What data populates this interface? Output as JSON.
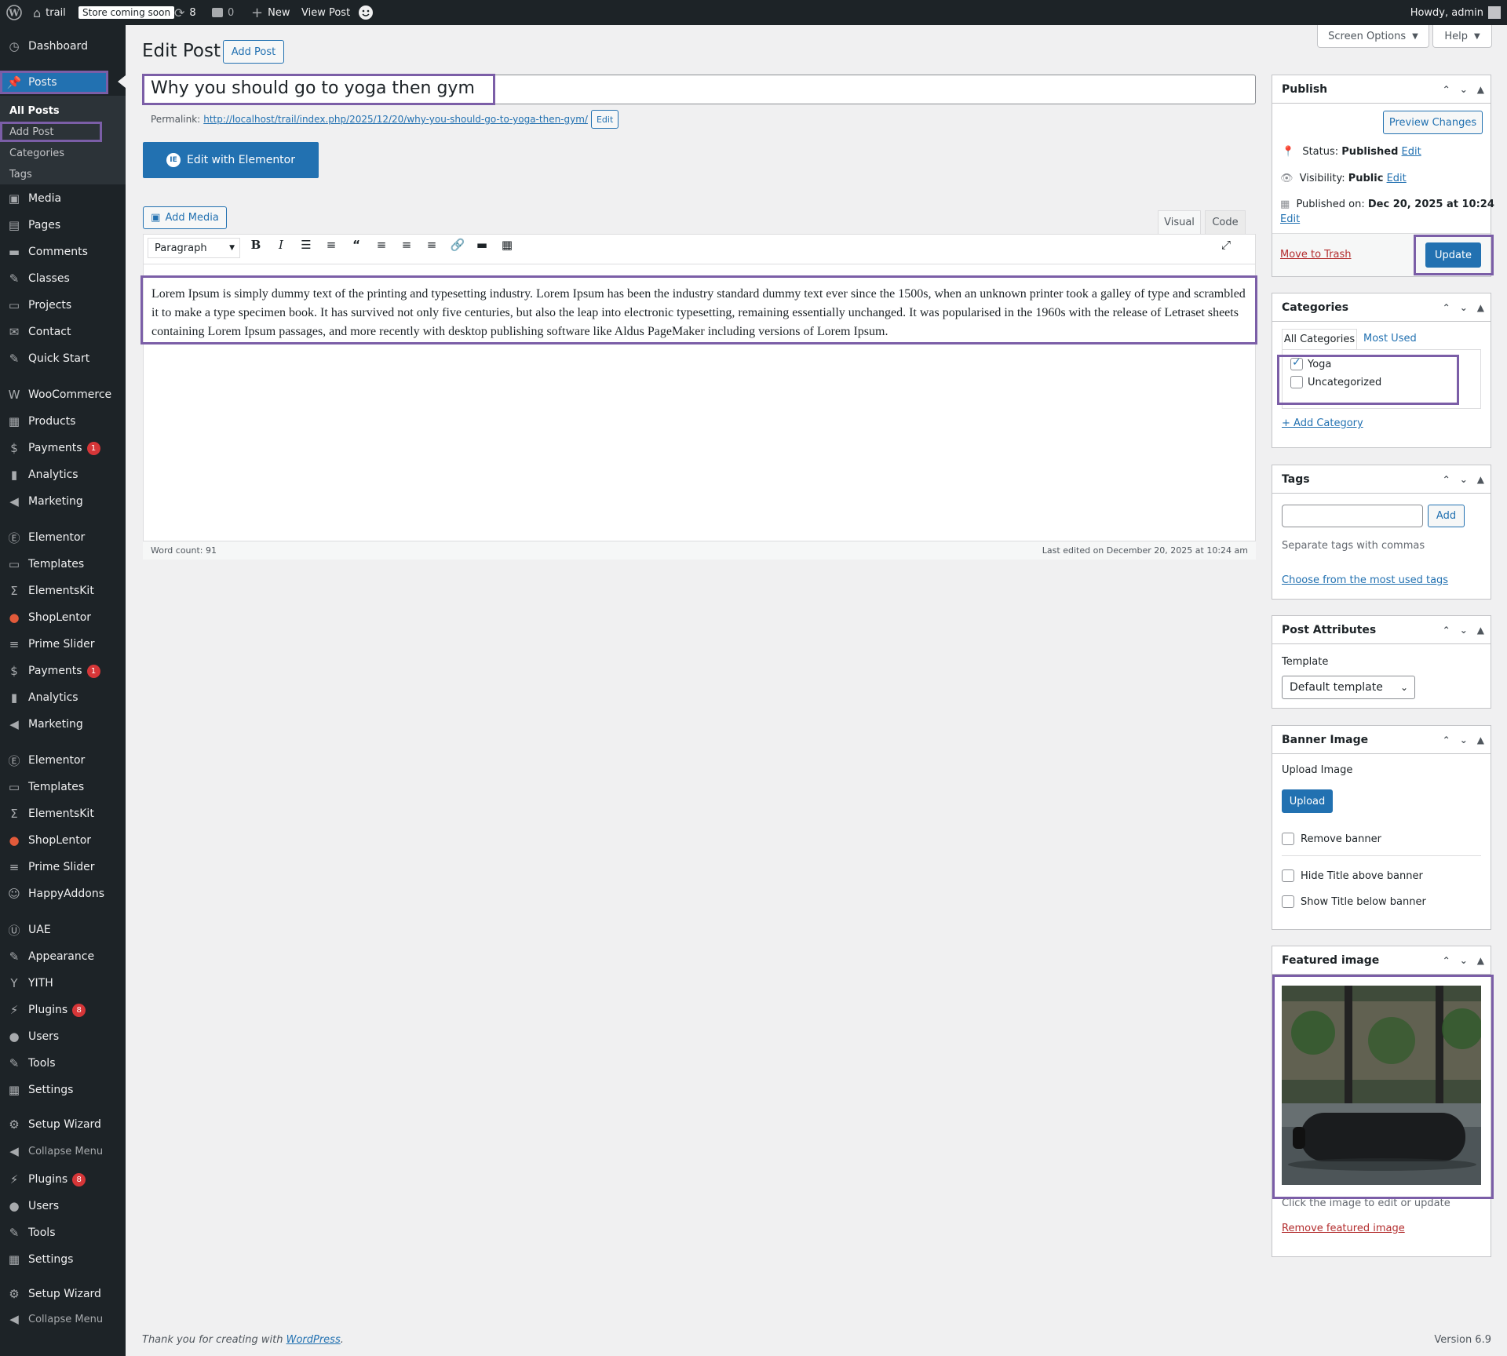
{
  "adminbar": {
    "site_name": "trail",
    "store_badge": "Store coming soon",
    "updates_count": "8",
    "comments_count": "0",
    "new_label": "New",
    "view_post_label": "View Post",
    "howdy": "Howdy, admin"
  },
  "sidebar": {
    "items": [
      {
        "label": "Dashboard",
        "icon": "dashboard-icon"
      },
      {
        "label": "Posts",
        "icon": "pin-icon"
      },
      {
        "label": "Media",
        "icon": "media-icon"
      },
      {
        "label": "Pages",
        "icon": "pages-icon"
      },
      {
        "label": "Comments",
        "icon": "comments-icon"
      },
      {
        "label": "Classes",
        "icon": "wrench-icon"
      },
      {
        "label": "Projects",
        "icon": "folder-icon"
      },
      {
        "label": "Contact",
        "icon": "mail-icon"
      },
      {
        "label": "Quick Start",
        "icon": "wrench-icon"
      },
      {
        "label": "WooCommerce",
        "icon": "woo-icon"
      },
      {
        "label": "Products",
        "icon": "archive-icon"
      },
      {
        "label": "Payments",
        "icon": "payments-icon",
        "badge": "1"
      },
      {
        "label": "Analytics",
        "icon": "analytics-icon"
      },
      {
        "label": "Marketing",
        "icon": "megaphone-icon"
      },
      {
        "label": "Elementor",
        "icon": "elementor-icon"
      },
      {
        "label": "Templates",
        "icon": "folder-icon"
      },
      {
        "label": "ElementsKit",
        "icon": "ekit-icon"
      },
      {
        "label": "ShopLentor",
        "icon": "shoplentor-icon"
      },
      {
        "label": "Prime Slider",
        "icon": "slider-icon"
      },
      {
        "label": "Payments",
        "icon": "payments-icon",
        "badge": "1"
      },
      {
        "label": "Analytics",
        "icon": "analytics-icon"
      },
      {
        "label": "Marketing",
        "icon": "megaphone-icon"
      },
      {
        "label": "Elementor",
        "icon": "elementor-icon"
      },
      {
        "label": "Templates",
        "icon": "folder-icon"
      },
      {
        "label": "ElementsKit",
        "icon": "ekit-icon"
      },
      {
        "label": "ShopLentor",
        "icon": "shoplentor-icon"
      },
      {
        "label": "Prime Slider",
        "icon": "slider-icon"
      },
      {
        "label": "HappyAddons",
        "icon": "happy-icon"
      },
      {
        "label": "UAE",
        "icon": "uae-icon"
      },
      {
        "label": "Appearance",
        "icon": "brush-icon"
      },
      {
        "label": "YITH",
        "icon": "yith-icon"
      },
      {
        "label": "Plugins",
        "icon": "plugin-icon",
        "badge": "8"
      },
      {
        "label": "Users",
        "icon": "users-icon"
      },
      {
        "label": "Tools",
        "icon": "wrench-icon"
      },
      {
        "label": "Settings",
        "icon": "settings-icon"
      },
      {
        "label": "Setup Wizard",
        "icon": "gear-icon"
      },
      {
        "label": "Collapse Menu",
        "icon": "collapse-icon"
      },
      {
        "label": "Plugins",
        "icon": "plugin-icon",
        "badge": "8"
      },
      {
        "label": "Users",
        "icon": "users-icon"
      },
      {
        "label": "Tools",
        "icon": "wrench-icon"
      },
      {
        "label": "Settings",
        "icon": "settings-icon"
      },
      {
        "label": "Setup Wizard",
        "icon": "gear-icon"
      },
      {
        "label": "Collapse Menu",
        "icon": "collapse-icon"
      }
    ],
    "posts_submenu": [
      "All Posts",
      "Add Post",
      "Categories",
      "Tags"
    ]
  },
  "header": {
    "page_title": "Edit Post",
    "add_post_button": "Add Post",
    "screen_options": "Screen Options",
    "help": "Help"
  },
  "editor": {
    "post_title": "Why you should go to yoga then gym",
    "permalink_label": "Permalink:",
    "permalink_url": "http://localhost/trail/index.php/2025/12/20/why-you-should-go-to-yoga-then-gym/",
    "permalink_edit": "Edit",
    "elementor_button": "Edit with Elementor",
    "add_media": "Add Media",
    "tab_visual": "Visual",
    "tab_code": "Code",
    "format_select": "Paragraph",
    "content": "Lorem Ipsum is simply dummy text of the printing and typesetting industry. Lorem Ipsum has been the industry standard dummy text ever since the 1500s, when an unknown printer took a galley of type and scrambled it to make a type specimen book. It has survived not only five centuries, but also the leap into electronic typesetting, remaining essentially unchanged. It was popularised in the 1960s with the release of Letraset sheets containing Lorem Ipsum passages, and more recently with desktop publishing software like Aldus PageMaker including versions of Lorem Ipsum.",
    "word_count": "Word count: 91",
    "last_edited": "Last edited on December 20, 2025 at 10:24 am"
  },
  "publish": {
    "title": "Publish",
    "preview_button": "Preview Changes",
    "status_label": "Status:",
    "status_value": "Published",
    "visibility_label": "Visibility:",
    "visibility_value": "Public",
    "published_label": "Published on:",
    "published_value": "Dec 20, 2025 at 10:24",
    "edit_link": "Edit",
    "trash_link": "Move to Trash",
    "update_button": "Update"
  },
  "categories": {
    "title": "Categories",
    "tab_all": "All Categories",
    "tab_used": "Most Used",
    "items": [
      {
        "label": "Yoga",
        "checked": true
      },
      {
        "label": "Uncategorized",
        "checked": false
      }
    ],
    "add_link": "+ Add Category"
  },
  "tags": {
    "title": "Tags",
    "input_value": "",
    "add_button": "Add",
    "hint": "Separate tags with commas",
    "choose_link": "Choose from the most used tags"
  },
  "post_attributes": {
    "title": "Post Attributes",
    "template_label": "Template",
    "template_value": "Default template"
  },
  "banner": {
    "title": "Banner Image",
    "upload_label": "Upload Image",
    "upload_button": "Upload",
    "remove_banner": "Remove banner",
    "hide_title": "Hide Title above banner",
    "show_title": "Show Title below banner"
  },
  "featured": {
    "title": "Featured image",
    "hint": "Click the image to edit or update",
    "remove_link": "Remove featured image"
  },
  "footer": {
    "thanks_prefix": "Thank you for creating with",
    "thanks_link": "WordPress",
    "thanks_suffix": ".",
    "version": "Version 6.9"
  },
  "colors": {
    "admin_dark": "#1d2327",
    "accent": "#2271b1",
    "highlight": "#7b5ea7",
    "badge": "#d63638",
    "danger": "#b32d2e"
  }
}
